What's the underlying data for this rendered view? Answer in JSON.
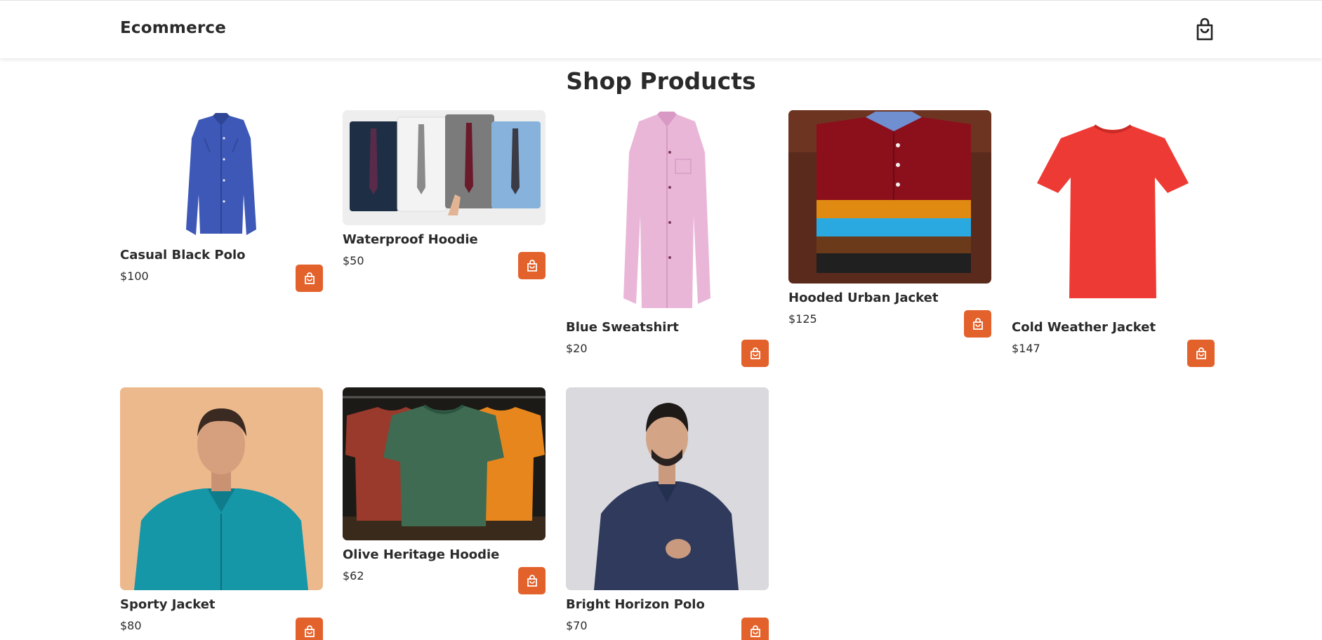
{
  "header": {
    "brand": "Ecommerce",
    "cart_icon": "shopping-bag-icon"
  },
  "page": {
    "title": "Shop Products"
  },
  "colors": {
    "accent": "#e3622c",
    "text": "#2b2b2b",
    "background": "#ffffff"
  },
  "products": [
    {
      "name": "Casual Black Polo",
      "price": "$100",
      "image": "blue-long-sleeve-shirt"
    },
    {
      "name": "Waterproof Hoodie",
      "price": "$50",
      "image": "four-shirts-with-ties"
    },
    {
      "name": "Blue Sweatshirt",
      "price": "$20",
      "image": "pink-checked-shirt"
    },
    {
      "name": "Hooded Urban Jacket",
      "price": "$125",
      "image": "folded-shirt-stack"
    },
    {
      "name": "Cold Weather Jacket",
      "price": "$147",
      "image": "red-t-shirt"
    },
    {
      "name": "Sporty Jacket",
      "price": "$80",
      "image": "man-in-teal-shirt"
    },
    {
      "name": "Olive Heritage Hoodie",
      "price": "$62",
      "image": "three-t-shirts-on-hangers"
    },
    {
      "name": "Bright Horizon Polo",
      "price": "$70",
      "image": "man-in-navy-print-shirt"
    }
  ],
  "actions": {
    "add_to_cart_icon": "shopping-bag-icon"
  }
}
